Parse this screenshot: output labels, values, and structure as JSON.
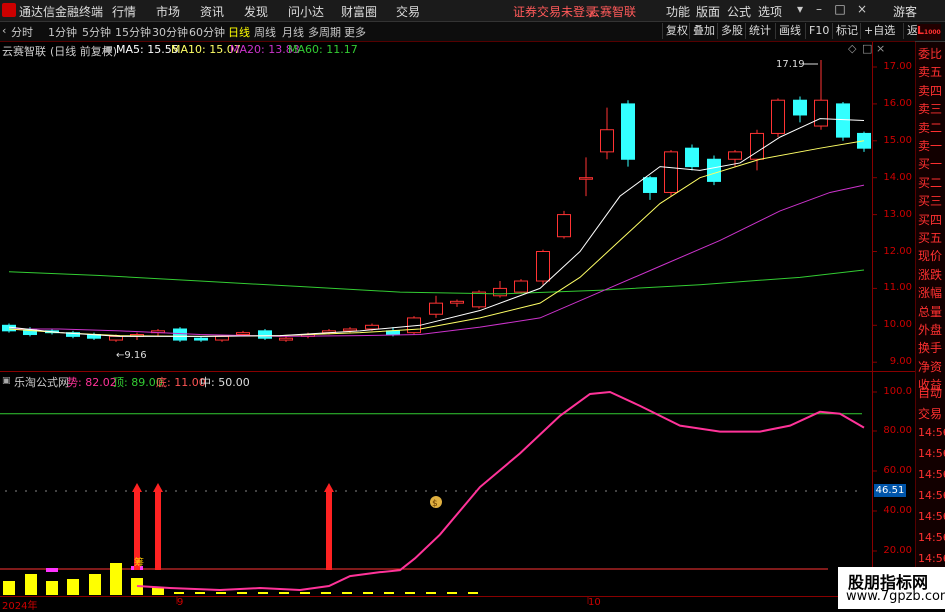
{
  "app": {
    "name": "通达信金融终端"
  },
  "menu": [
    "行情",
    "市场",
    "资讯",
    "发现",
    "问小达",
    "财富圈",
    "交易"
  ],
  "menu_right_red": [
    "证券交易未登录",
    "云赛智联"
  ],
  "menu_right": [
    "功能",
    "版面",
    "公式",
    "选项"
  ],
  "guest": "游客",
  "toolbar": {
    "periods": [
      "分时",
      "1分钟",
      "5分钟",
      "15分钟",
      "30分钟",
      "60分钟",
      "日线",
      "周线",
      "月线",
      "多周期",
      "更多"
    ],
    "active": "日线",
    "right_buttons": [
      "复权",
      "叠加",
      "多股",
      "统计",
      "画线",
      "F10",
      "标记",
      "+自选",
      "返回"
    ]
  },
  "main_chart": {
    "stock": "云赛智联",
    "mode": "(日线 前复权)",
    "ma5": "MA5: 15.55",
    "ma10": "MA10: 15.07",
    "ma20": "MA20: 13.83",
    "ma60": "MA60: 11.17",
    "high_label": "17.19",
    "low_label": "9.16",
    "ylim": [
      9.0,
      17.0
    ],
    "yticks": [
      "17.00",
      "16.00",
      "15.00",
      "14.00",
      "13.00",
      "12.00",
      "11.00",
      "10.00",
      "9.00"
    ],
    "colors": {
      "up": "#ff3333",
      "down": "#33ffff",
      "ma5": "#ffffff",
      "ma10": "#ffff66",
      "ma20": "#cc33cc",
      "ma60": "#33cc33"
    }
  },
  "right_panel_labels": [
    "委比",
    "卖五",
    "卖四",
    "卖三",
    "卖二",
    "卖一",
    "买一",
    "买二",
    "买三",
    "买四",
    "买五",
    "现价",
    "涨跌",
    "涨幅",
    "总量",
    "外盘",
    "换手",
    "净资",
    "收益"
  ],
  "right_panel_lower": [
    "自动",
    "交易",
    "14:56",
    "14:56",
    "14:56",
    "14:56",
    "14:56",
    "14:56",
    "14:56"
  ],
  "indicator": {
    "name": "乐淘公式网",
    "shi": "势: 82.02",
    "ding": "顶: 89.00",
    "di": "底: 11.00",
    "zhong": "中: 50.00",
    "yticks": [
      "100.0",
      "80.00",
      "60.00",
      "40.00",
      "20.00"
    ],
    "current_value": "46.51",
    "buy_marker": "$",
    "zheng_label": "筹"
  },
  "x_labels": [
    "2024年",
    "9",
    "10"
  ],
  "watermark": {
    "line1": "股朋指标网",
    "line2": "www.7gpzb.com"
  }
}
